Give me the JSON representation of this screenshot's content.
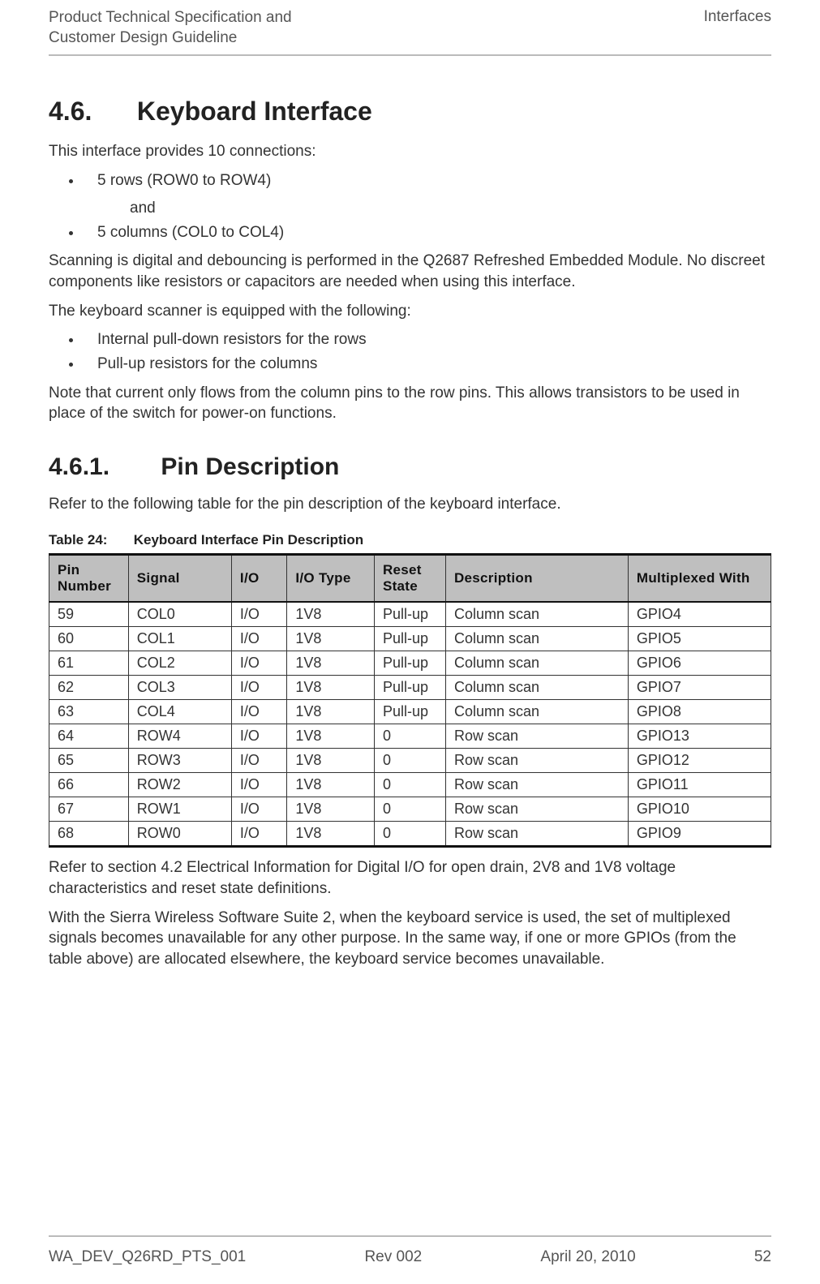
{
  "header": {
    "left_line1": "Product Technical Specification and",
    "left_line2": "Customer Design Guideline",
    "right": "Interfaces"
  },
  "section1": {
    "number": "4.6.",
    "title": "Keyboard Interface",
    "intro": "This interface provides 10 connections:",
    "bullet1": "5 rows (ROW0 to ROW4)",
    "and_word": "and",
    "bullet2": "5 columns (COL0 to COL4)",
    "para1": "Scanning is digital and debouncing is performed in the Q2687 Refreshed Embedded Module. No discreet components like resistors or capacitors are needed when using this interface.",
    "para2": "The keyboard scanner is equipped with the following:",
    "bullet3": "Internal pull-down resistors for the rows",
    "bullet4": "Pull-up resistors for the columns",
    "para3": "Note that current only flows from the column pins to the row pins. This allows transistors to be used in place of the switch for power-on functions."
  },
  "section2": {
    "number": "4.6.1.",
    "title": "Pin Description",
    "intro": "Refer to the following table for the pin description of the keyboard interface."
  },
  "table": {
    "caption_label": "Table 24:",
    "caption_text": "Keyboard Interface Pin Description",
    "headers": {
      "pin": "Pin Number",
      "signal": "Signal",
      "io": "I/O",
      "iotype": "I/O Type",
      "reset": "Reset State",
      "desc": "Description",
      "mux": "Multiplexed With"
    },
    "rows": [
      {
        "pin": "59",
        "signal": "COL0",
        "io": "I/O",
        "iotype": "1V8",
        "reset": "Pull-up",
        "desc": "Column scan",
        "mux": "GPIO4"
      },
      {
        "pin": "60",
        "signal": "COL1",
        "io": "I/O",
        "iotype": "1V8",
        "reset": "Pull-up",
        "desc": "Column scan",
        "mux": "GPIO5"
      },
      {
        "pin": "61",
        "signal": "COL2",
        "io": "I/O",
        "iotype": "1V8",
        "reset": "Pull-up",
        "desc": "Column scan",
        "mux": "GPIO6"
      },
      {
        "pin": "62",
        "signal": "COL3",
        "io": "I/O",
        "iotype": "1V8",
        "reset": "Pull-up",
        "desc": "Column scan",
        "mux": "GPIO7"
      },
      {
        "pin": "63",
        "signal": "COL4",
        "io": "I/O",
        "iotype": "1V8",
        "reset": "Pull-up",
        "desc": "Column scan",
        "mux": "GPIO8"
      },
      {
        "pin": "64",
        "signal": "ROW4",
        "io": "I/O",
        "iotype": "1V8",
        "reset": "0",
        "desc": "Row scan",
        "mux": "GPIO13"
      },
      {
        "pin": "65",
        "signal": "ROW3",
        "io": "I/O",
        "iotype": "1V8",
        "reset": "0",
        "desc": "Row scan",
        "mux": "GPIO12"
      },
      {
        "pin": "66",
        "signal": "ROW2",
        "io": "I/O",
        "iotype": "1V8",
        "reset": "0",
        "desc": "Row scan",
        "mux": "GPIO11"
      },
      {
        "pin": "67",
        "signal": "ROW1",
        "io": "I/O",
        "iotype": "1V8",
        "reset": "0",
        "desc": "Row scan",
        "mux": "GPIO10"
      },
      {
        "pin": "68",
        "signal": "ROW0",
        "io": "I/O",
        "iotype": "1V8",
        "reset": "0",
        "desc": "Row scan",
        "mux": "GPIO9"
      }
    ]
  },
  "after_table": {
    "para1": "Refer to section 4.2 Electrical Information for Digital I/O for open drain, 2V8 and 1V8 voltage characteristics and reset state definitions.",
    "para2": "With the Sierra Wireless Software Suite 2, when the keyboard service is used, the set of multiplexed signals becomes unavailable for any other purpose. In the same way, if one or more GPIOs (from the table above) are allocated elsewhere, the keyboard service becomes unavailable."
  },
  "footer": {
    "doc_id": "WA_DEV_Q26RD_PTS_001",
    "rev": "Rev 002",
    "date": "April 20, 2010",
    "page": "52"
  }
}
